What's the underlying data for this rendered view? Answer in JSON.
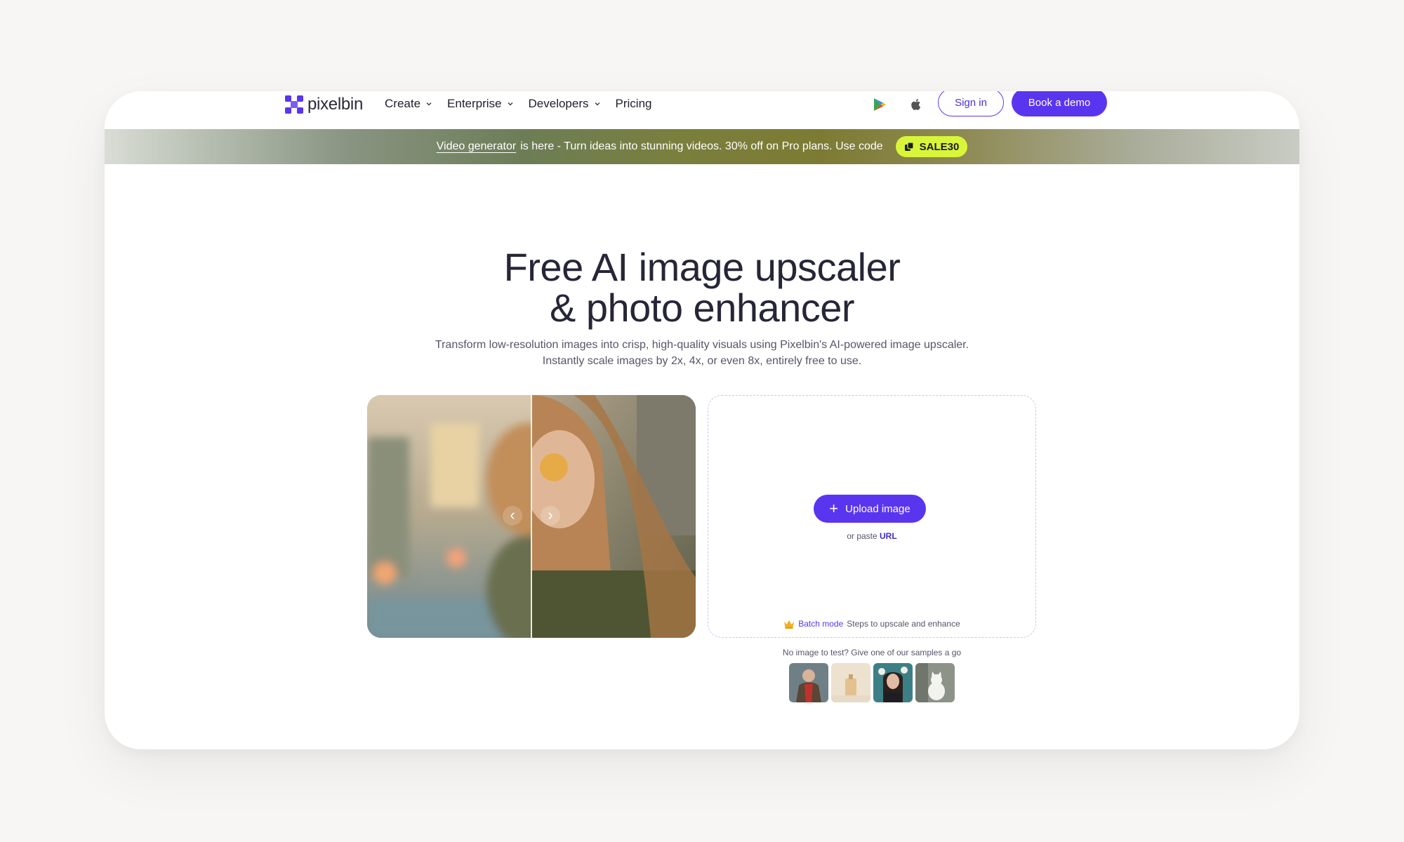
{
  "brand": {
    "name": "pixelbin",
    "accent": "#5a35f0",
    "coupon_bg": "#d9f53a"
  },
  "nav": {
    "items": [
      {
        "label": "Create",
        "dropdown": true
      },
      {
        "label": "Enterprise",
        "dropdown": true
      },
      {
        "label": "Developers",
        "dropdown": true
      },
      {
        "label": "Pricing",
        "dropdown": false
      }
    ],
    "icons": [
      "google-play-icon",
      "apple-icon"
    ],
    "signin_label": "Sign in",
    "demo_label": "Book a demo"
  },
  "banner": {
    "link_text": "Video generator",
    "text": "is here - Turn ideas into stunning videos. 30% off on Pro plans. Use code",
    "coupon_code": "SALE30"
  },
  "hero": {
    "title_line1": "Free AI image upscaler",
    "title_line2": "& photo enhancer",
    "subtitle_line1": "Transform low-resolution images into crisp, high-quality visuals using Pixelbin's AI-powered image upscaler.",
    "subtitle_line2": "Instantly scale images by 2x, 4x, or even 8x, entirely free to use."
  },
  "upload": {
    "button_label": "Upload image",
    "or_paste": "or paste",
    "url_label": "URL",
    "batch_label": "Batch mode",
    "batch_text": "Steps to upscale and enhance"
  },
  "samples": {
    "label": "No image to test? Give one of our samples a go",
    "items": [
      "sample-man-red-scarf",
      "sample-perfume-bottle",
      "sample-girl-flowers",
      "sample-white-cat"
    ]
  }
}
